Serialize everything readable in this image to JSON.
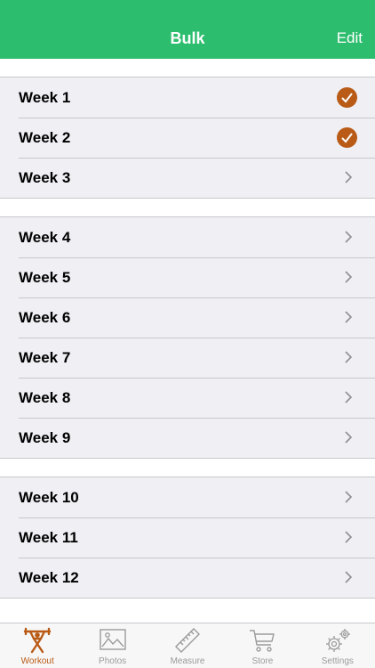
{
  "colors": {
    "accent": "#2dbd6e",
    "check": "#b95b17",
    "active_tab": "#b95b17"
  },
  "header": {
    "title": "Bulk",
    "edit_label": "Edit"
  },
  "sections": [
    {
      "rows": [
        {
          "label": "Week 1",
          "status": "complete"
        },
        {
          "label": "Week 2",
          "status": "complete"
        },
        {
          "label": "Week 3",
          "status": "open"
        }
      ]
    },
    {
      "rows": [
        {
          "label": "Week 4",
          "status": "open"
        },
        {
          "label": "Week 5",
          "status": "open"
        },
        {
          "label": "Week 6",
          "status": "open"
        },
        {
          "label": "Week 7",
          "status": "open"
        },
        {
          "label": "Week 8",
          "status": "open"
        },
        {
          "label": "Week 9",
          "status": "open"
        }
      ]
    },
    {
      "rows": [
        {
          "label": "Week 10",
          "status": "open"
        },
        {
          "label": "Week 11",
          "status": "open"
        },
        {
          "label": "Week 12",
          "status": "open"
        }
      ]
    }
  ],
  "tabs": [
    {
      "label": "Workout",
      "icon": "weightlifter-icon",
      "active": true
    },
    {
      "label": "Photos",
      "icon": "photo-icon",
      "active": false
    },
    {
      "label": "Measure",
      "icon": "ruler-icon",
      "active": false
    },
    {
      "label": "Store",
      "icon": "cart-icon",
      "active": false
    },
    {
      "label": "Settings",
      "icon": "gears-icon",
      "active": false
    }
  ]
}
